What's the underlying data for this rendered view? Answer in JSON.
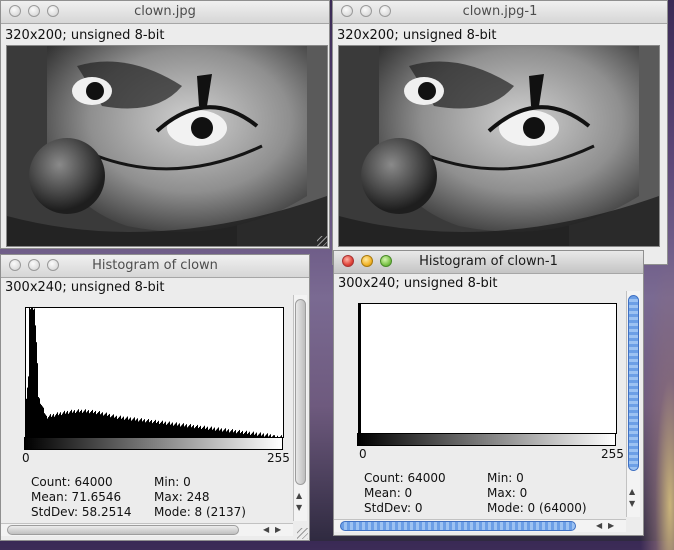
{
  "windows": {
    "clown": {
      "title": "clown.jpg",
      "info": "320x200; unsigned 8-bit"
    },
    "clown_copy": {
      "title": "clown.jpg-1",
      "info": "320x200; unsigned 8-bit"
    },
    "hist_clown": {
      "title": "Histogram of clown",
      "info": "300x240; unsigned 8-bit",
      "axis_min": "0",
      "axis_max": "255",
      "stats": {
        "count": "Count: 64000",
        "mean": "Mean: 71.6546",
        "stddev": "StdDev: 58.2514",
        "min": "Min: 0",
        "max": "Max: 248",
        "mode": "Mode: 8 (2137)"
      }
    },
    "hist_clown_copy": {
      "title": "Histogram of clown-1",
      "info": "300x240; unsigned 8-bit",
      "axis_min": "0",
      "axis_max": "255",
      "stats": {
        "count": "Count: 64000",
        "mean": "Mean: 0",
        "stddev": "StdDev: 0",
        "min": "Min: 0",
        "max": "Max: 0",
        "mode": "Mode: 0 (64000)"
      }
    }
  },
  "icons": [
    "close-icon",
    "minimize-icon",
    "zoom-icon",
    "resize-grip-icon",
    "scroll-left-icon",
    "scroll-right-icon",
    "scroll-up-icon",
    "scroll-down-icon"
  ]
}
